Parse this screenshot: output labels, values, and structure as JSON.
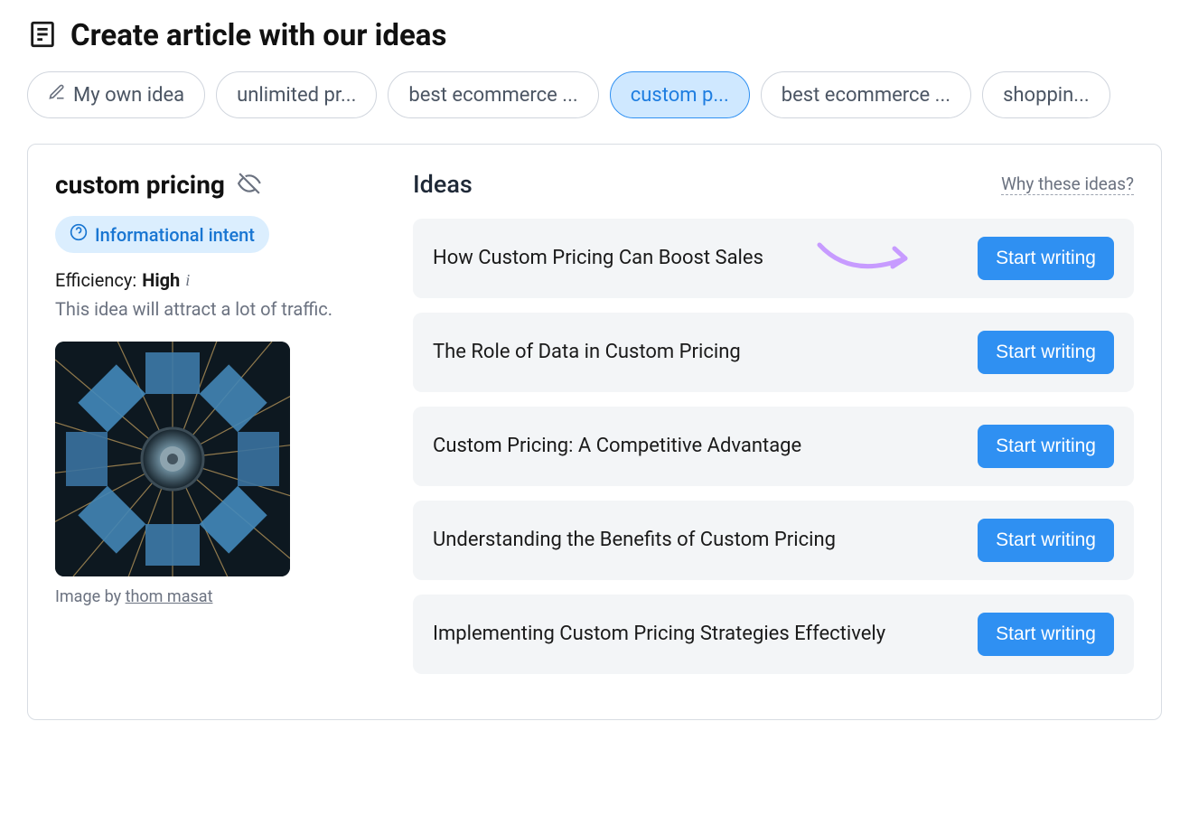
{
  "header": {
    "title": "Create article with our ideas"
  },
  "chips": {
    "my_own": "My own idea",
    "items": [
      "unlimited pr...",
      "best ecommerce ...",
      "custom p...",
      "best ecommerce ...",
      "shoppin..."
    ],
    "active_index": 2
  },
  "topic": {
    "title": "custom pricing",
    "intent_label": "Informational intent",
    "efficiency_prefix": "Efficiency: ",
    "efficiency_value": "High",
    "efficiency_desc": "This idea will attract a lot of traffic.",
    "image_credit_prefix": "Image by ",
    "image_credit_author": "thom masat"
  },
  "ideas": {
    "heading": "Ideas",
    "why_link": "Why these ideas?",
    "start_label": "Start writing",
    "list": [
      "How Custom Pricing Can Boost Sales",
      "The Role of Data in Custom Pricing",
      "Custom Pricing: A Competitive Advantage",
      "Understanding the Benefits of Custom Pricing",
      "Implementing Custom Pricing Strategies Effectively"
    ]
  },
  "colors": {
    "accent_blue": "#2f90f2",
    "highlight_purple": "#b98cff",
    "badge_bg": "#dbeefe",
    "card_bg": "#f3f5f7"
  }
}
